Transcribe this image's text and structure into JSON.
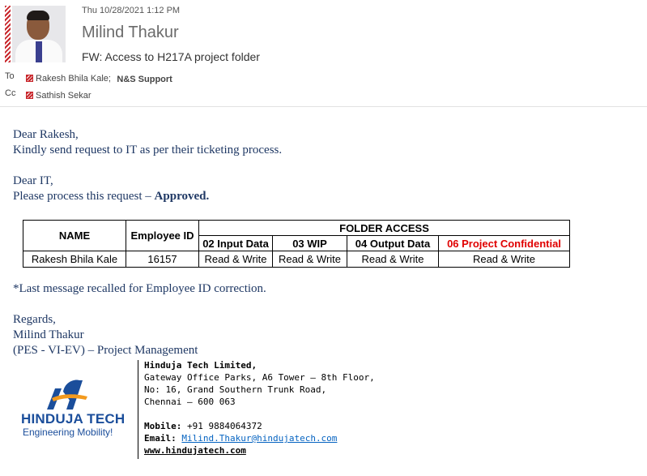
{
  "header": {
    "date": "Thu 10/28/2021 1:12 PM",
    "sender": "Milind Thakur",
    "subject": "FW: Access to H217A project folder",
    "to_label": "To",
    "to_recipients": [
      "Rakesh Bhila Kale;",
      "N&S Support"
    ],
    "cc_label": "Cc",
    "cc_recipients": [
      "Sathish Sekar"
    ]
  },
  "body": {
    "lines": [
      "Dear Rakesh,",
      "Kindly send request to IT as per their ticketing process.",
      "Dear IT,",
      "Please process this request – "
    ],
    "approved": "Approved.",
    "note": "*Last message recalled for Employee ID correction.",
    "regards": [
      "Regards,",
      "Milind Thakur",
      "(PES - VI-EV) – Project Management"
    ]
  },
  "table": {
    "col_name": "NAME",
    "col_emp": "Employee ID",
    "folder_access": "FOLDER ACCESS",
    "folders": [
      "02 Input Data",
      "03 WIP",
      "04 Output Data",
      "06 Project Confidential"
    ],
    "row": {
      "name": "Rakesh Bhila Kale",
      "emp_id": "16157",
      "access": [
        "Read & Write",
        "Read & Write",
        "Read & Write",
        "Read & Write"
      ]
    }
  },
  "signature": {
    "logo_line1": "HINDUJA TECH",
    "logo_line2": "Engineering Mobility!",
    "company": "Hinduja Tech Limited,",
    "address": [
      "Gateway Office Parks, A6 Tower – 8th Floor,",
      "No: 16, Grand Southern Trunk Road,",
      "Chennai – 600 063"
    ],
    "mobile_label": "Mobile:",
    "mobile": "+91 9884064372",
    "email_label": "Email:",
    "email": "Milind.Thakur@hindujatech.com",
    "website": "www.hindujatech.com"
  },
  "colors": {
    "body_text": "#1f3864",
    "confidential": "#e00000",
    "link": "#0563c1",
    "logo_blue": "#1b4e9b",
    "logo_orange": "#f39a1e"
  }
}
